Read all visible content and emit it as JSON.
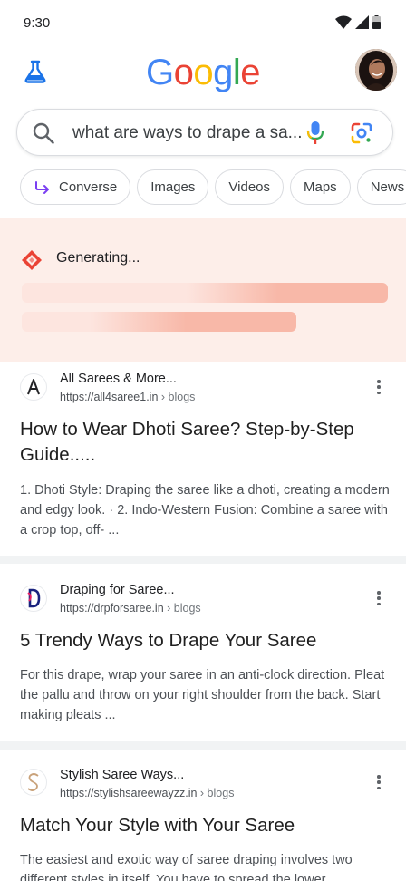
{
  "status_bar": {
    "time": "9:30"
  },
  "header": {
    "logo_letters": [
      "G",
      "o",
      "o",
      "g",
      "l",
      "e"
    ],
    "logo_colors": [
      "#4285F4",
      "#EA4335",
      "#FBBC05",
      "#4285F4",
      "#34A853",
      "#EA4335"
    ]
  },
  "search": {
    "query": "what are ways to drape a sa..."
  },
  "chips": [
    {
      "label": "Converse",
      "icon": "arrow-turn-icon"
    },
    {
      "label": "Images"
    },
    {
      "label": "Videos"
    },
    {
      "label": "Maps"
    },
    {
      "label": "News"
    }
  ],
  "ai_overview": {
    "status": "Generating...",
    "accent": "#EA4335",
    "bar_color": "#f8b8a8"
  },
  "results": [
    {
      "site_name": "All Sarees & More...",
      "url": "https://all4saree1.in",
      "crumb": " › blogs",
      "title": "How to Wear Dhoti Saree? Step-by-Step Guide.....",
      "snippet": "1. Dhoti Style: Draping the saree like a dhoti, creating a modern and edgy look. · 2. Indo-Western Fusion: Combine a saree with a crop top, off- ..."
    },
    {
      "site_name": "Draping for Saree...",
      "url": "https://drpforsaree.in",
      "crumb": " › blogs",
      "title": "5 Trendy Ways to Drape Your Saree",
      "snippet": "For this drape, wrap your saree in an anti-clock direction. Pleat the pallu and throw on your right shoulder from the back. Start making pleats ..."
    },
    {
      "site_name": "Stylish Saree Ways...",
      "url": "https://stylishsareewayzz.in",
      "crumb": " › blogs",
      "title": "Match Your Style with Your Saree",
      "snippet": "The easiest and exotic way of saree draping involves two different styles in itself. You have to spread the lower"
    }
  ]
}
